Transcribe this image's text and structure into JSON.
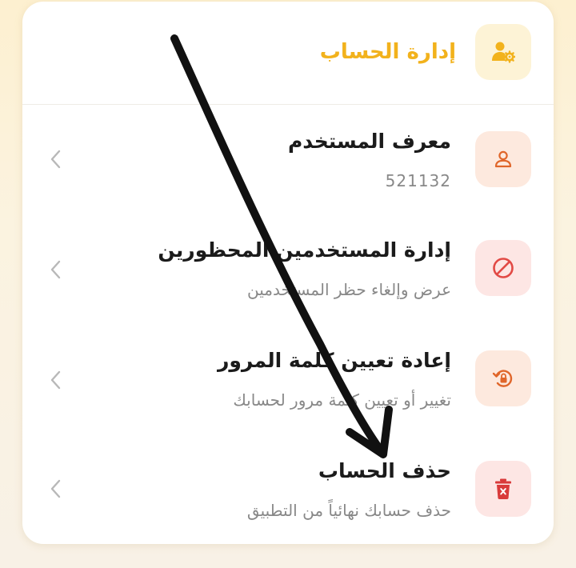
{
  "header": {
    "title": "إدارة الحساب",
    "icon": "user-gear-icon",
    "accent": "#f2b21c"
  },
  "rows": [
    {
      "title": "معرف المستخدم",
      "subtitle": "521132",
      "icon": "user-icon",
      "icon_color": "#e0662a",
      "icon_bg": "#fde9de"
    },
    {
      "title": "إدارة المستخدمين المحظورين",
      "subtitle": "عرض وإلغاء حظر المستخدمين",
      "icon": "block-icon",
      "icon_color": "#e24a45",
      "icon_bg": "#fde6e4"
    },
    {
      "title": "إعادة تعيين كلمة المرور",
      "subtitle": "تغيير أو تعيين كلمة مرور لحسابك",
      "icon": "lock-reset-icon",
      "icon_color": "#e0662a",
      "icon_bg": "#fde9de"
    },
    {
      "title": "حذف الحساب",
      "subtitle": "حذف حسابك نهائياً من التطبيق",
      "icon": "trash-icon",
      "icon_color": "#d93a3a",
      "icon_bg": "#fde6e4"
    }
  ],
  "annotation": {
    "icon": "hand-drawn-arrow-icon",
    "color": "#111111"
  }
}
